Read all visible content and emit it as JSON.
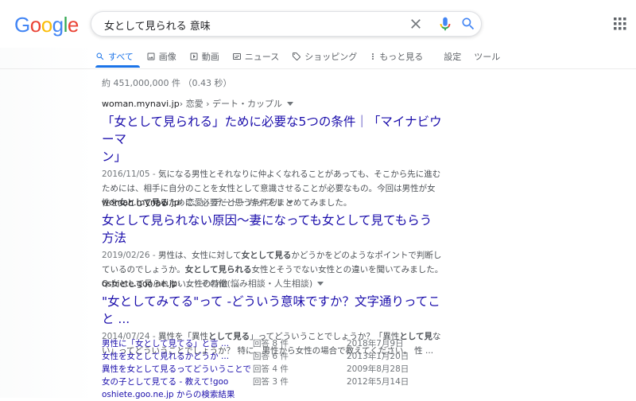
{
  "logo": {
    "letters": [
      "G",
      "o",
      "o",
      "g",
      "l",
      "e"
    ],
    "colors": [
      "#4285F4",
      "#EA4335",
      "#FBBC05",
      "#4285F4",
      "#34A853",
      "#EA4335"
    ]
  },
  "search": {
    "query": "女として見られる 意味"
  },
  "tabs": [
    {
      "label": "すべて",
      "icon": "search-icon"
    },
    {
      "label": "画像",
      "icon": "image-icon"
    },
    {
      "label": "動画",
      "icon": "video-icon"
    },
    {
      "label": "ニュース",
      "icon": "news-icon"
    },
    {
      "label": "ショッピング",
      "icon": "tag-icon"
    },
    {
      "label": "もっと見る",
      "icon": "more-vert-icon"
    },
    {
      "label": "設定"
    },
    {
      "label": "ツール"
    }
  ],
  "stats": "約 451,000,000 件 （0.43 秒）",
  "results": [
    {
      "site": "woman.mynavi.jp",
      "path": " › 恋愛 › デート・カップル",
      "title_line1": "「女として見られる」ために必要な5つの条件｜「マイナビウーマ",
      "title_line2": "ン」",
      "date": "2016/11/05 - ",
      "snippet_a": "気になる男性とそれなりに仲よくなれることがあっても、そこから先に進むためには、相手に自分のことを女性として意識させることが必要なもの。今回は男性が女性を",
      "snippet_b1": "女として見る",
      "snippet_c": "ために、必要だと思う条件をまとめてみました。"
    },
    {
      "site": "woman.mynavi.jp",
      "path": " › 恋愛 › デート・カップル",
      "title_line1": "女として見られない原因〜妻になっても女として見てもらう方法",
      "date": "2019/02/26 - ",
      "snippet_a": "男性は、女性に対して",
      "snippet_b1": "女として見る",
      "snippet_c": "かどうかをどのようなポイントで判断しているのでしょうか。",
      "snippet_b2": "女として見られる",
      "snippet_d": "女性とそうでない女性との違いを聞いてみました。 Q.女として見られない女性の特徴 ..."
    },
    {
      "site": "oshiete.goo.ne.jp",
      "path": " › ... › その他(悩み相談・人生相談)",
      "title_line1": "\"女としてみてる\"って -どういう意味ですか？文字通りってこと ...",
      "date": "2014/07/24 - ",
      "snippet_a": "異性を「異性",
      "snippet_b1": "として見る",
      "snippet_c": "」ってどういうことでしょうか？「異性",
      "snippet_b2": "として見",
      "snippet_d": "ない」ってどういうことでしょうか？ 特に、男性から女性の場合で教えてください。 性 ..."
    }
  ],
  "qa": [
    {
      "q": "男性に「女として見てる」と言 ...",
      "answers": "回答 8 件",
      "date": "2018年7月9日"
    },
    {
      "q": "女性を女として見れるかどうか ...",
      "answers": "回答 6 件",
      "date": "2013年1月20日"
    },
    {
      "q": "異性を女として見るってどういうことでし ...",
      "answers": "回答 4 件",
      "date": "2009年8月28日"
    },
    {
      "q": "女の子として見てる - 教えて!goo",
      "answers": "回答 3 件",
      "date": "2012年5月14日"
    }
  ],
  "qa_more": "oshiete.goo.ne.jp からの検索結果"
}
